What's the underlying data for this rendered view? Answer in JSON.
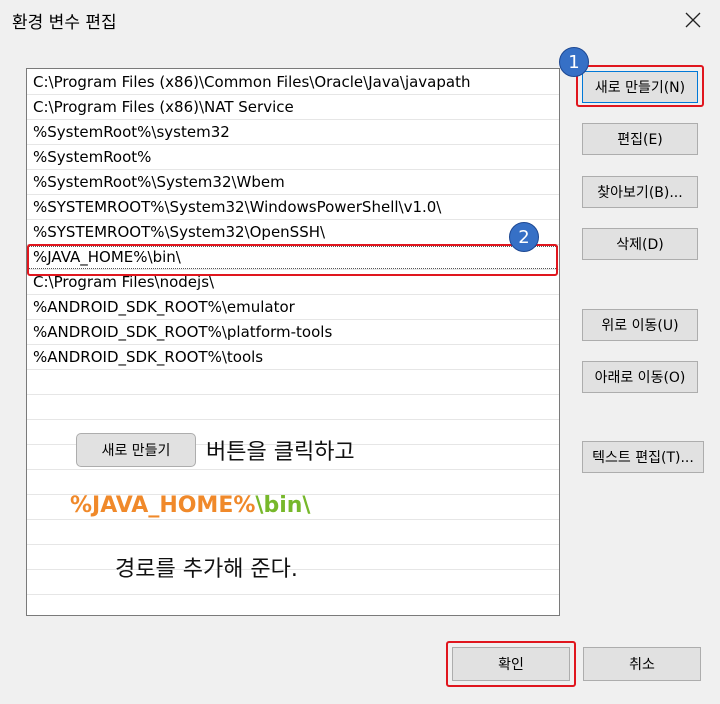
{
  "window": {
    "title": "환경 변수 편집"
  },
  "list": {
    "items": [
      "C:\\Program Files (x86)\\Common Files\\Oracle\\Java\\javapath",
      "C:\\Program Files (x86)\\NAT Service",
      "%SystemRoot%\\system32",
      "%SystemRoot%",
      "%SystemRoot%\\System32\\Wbem",
      "%SYSTEMROOT%\\System32\\WindowsPowerShell\\v1.0\\",
      "%SYSTEMROOT%\\System32\\OpenSSH\\",
      "%JAVA_HOME%\\bin\\",
      "C:\\Program Files\\nodejs\\",
      "%ANDROID_SDK_ROOT%\\emulator",
      "%ANDROID_SDK_ROOT%\\platform-tools",
      "%ANDROID_SDK_ROOT%\\tools"
    ]
  },
  "buttons": {
    "new": "새로 만들기(N)",
    "edit": "편집(E)",
    "browse": "찾아보기(B)...",
    "delete": "삭제(D)",
    "move_up": "위로 이동(U)",
    "move_down": "아래로 이동(O)",
    "edit_text": "텍스트 편집(T)...",
    "ok": "확인",
    "cancel": "취소"
  },
  "annotations": {
    "badge1": "1",
    "badge2": "2",
    "inline_button": "새로 만들기",
    "line1": "버튼을 클릭하고",
    "path_part1": "%JAVA_HOME%",
    "path_part2": "\\bin\\",
    "line3": "경로를 추가해 준다."
  },
  "colors": {
    "highlight_red": "#e0161e",
    "badge_blue": "#3670c6",
    "path_orange": "#f0892a",
    "path_green": "#77b82b"
  }
}
